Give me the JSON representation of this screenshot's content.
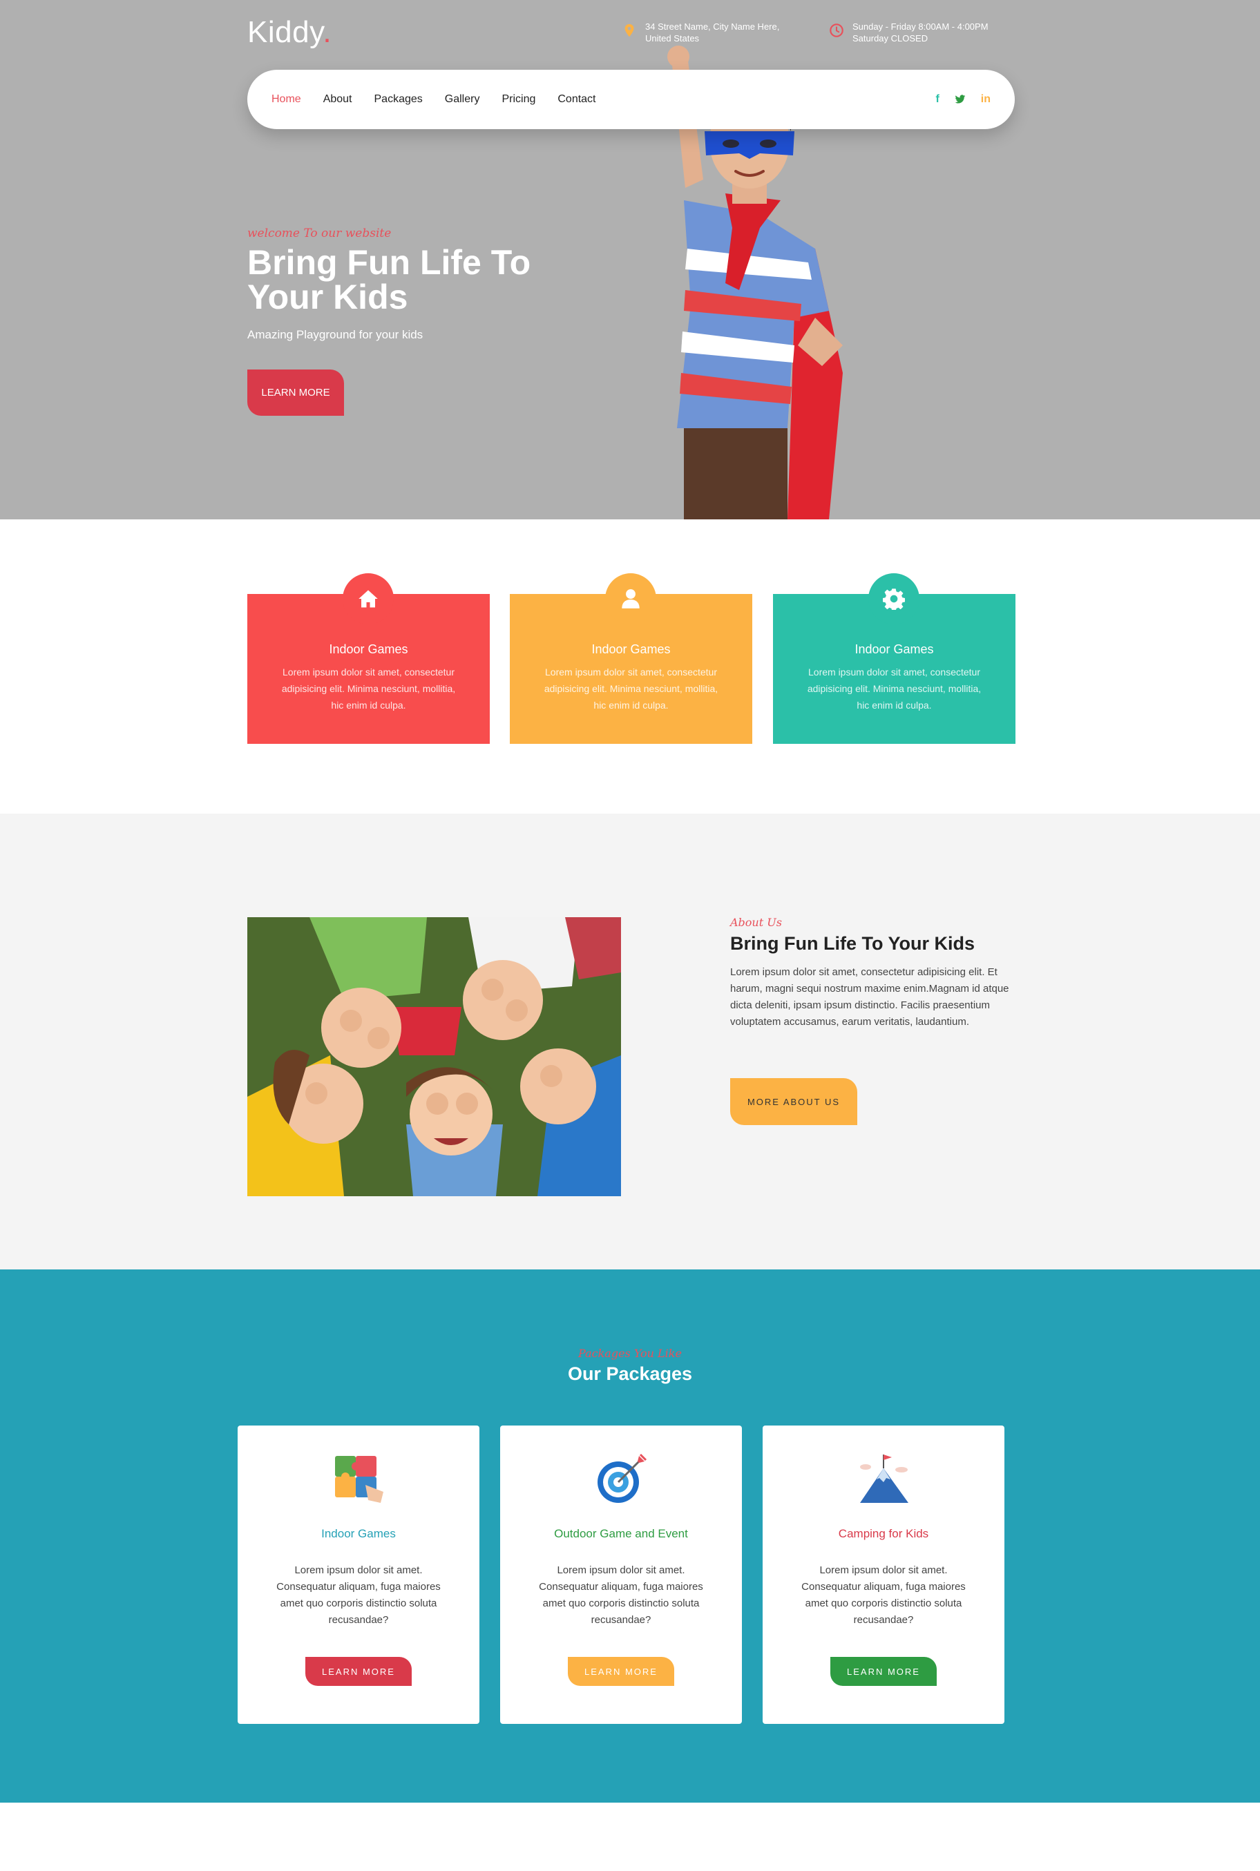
{
  "brand": {
    "name": "Kiddy",
    "dot": ".",
    "accent": "#e8515b"
  },
  "topbar": {
    "address_line1": "34 Street Name, City Name Here,",
    "address_line2": "United States",
    "hours_line1": "Sunday - Friday 8:00AM - 4:00PM",
    "hours_line2": "Saturday CLOSED"
  },
  "nav": {
    "items": [
      {
        "label": "Home",
        "active": true
      },
      {
        "label": "About"
      },
      {
        "label": "Packages"
      },
      {
        "label": "Gallery"
      },
      {
        "label": "Pricing"
      },
      {
        "label": "Contact"
      }
    ],
    "socials": [
      {
        "icon": "facebook-icon",
        "glyph": "f",
        "color": "#2bc0a8"
      },
      {
        "icon": "twitter-icon",
        "glyph": "t",
        "color": "#2e9c42"
      },
      {
        "icon": "linkedin-icon",
        "glyph": "in",
        "color": "#fcb244"
      }
    ]
  },
  "hero": {
    "welcome": "welcome To our website",
    "title": "Bring Fun Life To Your Kids",
    "subtitle": "Amazing Playground for your kids",
    "button": "LEARN MORE",
    "background": "#b0b0b0"
  },
  "features": [
    {
      "icon": "home-icon",
      "title": "Indoor Games",
      "text": "Lorem ipsum dolor sit amet, consectetur adipisicing elit. Minima nesciunt, mollitia, hic enim id culpa.",
      "color": "#f84d4d"
    },
    {
      "icon": "user-icon",
      "title": "Indoor Games",
      "text": "Lorem ipsum dolor sit amet, consectetur adipisicing elit. Minima nesciunt, mollitia, hic enim id culpa.",
      "color": "#fcb244"
    },
    {
      "icon": "gear-icon",
      "title": "Indoor Games",
      "text": "Lorem ipsum dolor sit amet, consectetur adipisicing elit. Minima nesciunt, mollitia, hic enim id culpa.",
      "color": "#2bc0a8"
    }
  ],
  "about": {
    "small": "About Us",
    "title": "Bring Fun Life To Your Kids",
    "text": "Lorem ipsum dolor sit amet, consectetur adipisicing elit. Et harum, magni sequi nostrum maxime enim.Magnam id atque dicta deleniti, ipsam ipsum distinctio. Facilis praesentium voluptatem accusamus, earum veritatis, laudantium.",
    "button": "MORE ABOUT US"
  },
  "packages": {
    "small": "Packages You Like",
    "title": "Our Packages",
    "background": "#25a1b6",
    "items": [
      {
        "icon": "puzzle-icon",
        "title": "Indoor Games",
        "text": "Lorem ipsum dolor sit amet. Consequatur aliquam, fuga maiores amet quo corporis distinctio soluta recusandae?",
        "button": "LEARN MORE"
      },
      {
        "icon": "target-icon",
        "title": "Outdoor Game and Event",
        "text": "Lorem ipsum dolor sit amet. Consequatur aliquam, fuga maiores amet quo corporis distinctio soluta recusandae?",
        "button": "LEARN MORE"
      },
      {
        "icon": "mountain-flag-icon",
        "title": "Camping for Kids",
        "text": "Lorem ipsum dolor sit amet. Consequatur aliquam, fuga maiores amet quo corporis distinctio soluta recusandae?",
        "button": "LEARN MORE"
      }
    ]
  }
}
